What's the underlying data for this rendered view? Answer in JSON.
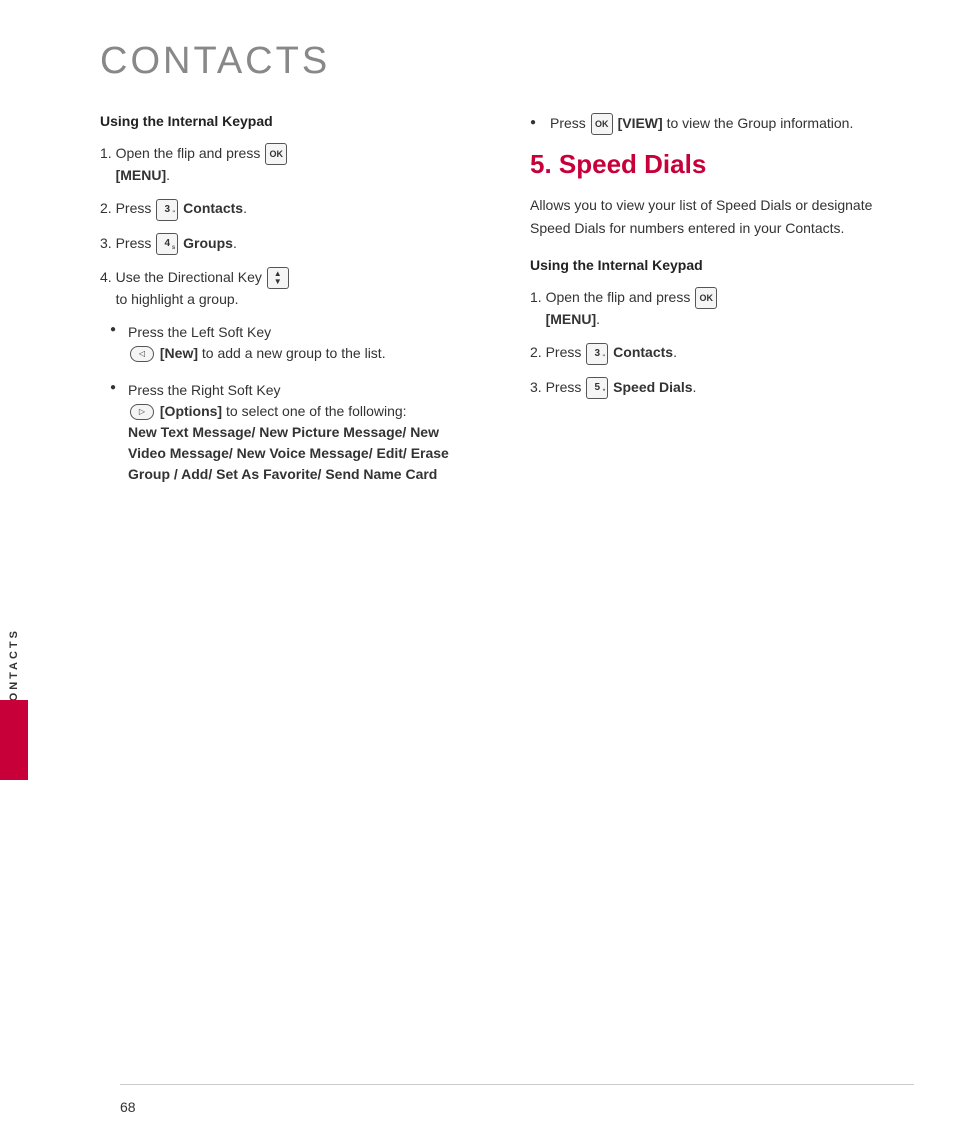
{
  "page": {
    "title": "CONTACTS",
    "page_number": "68",
    "sidebar_label": "CONTACTS"
  },
  "left_column": {
    "section_heading": "Using the Internal Keypad",
    "steps": [
      {
        "num": "1.",
        "text_before": "Open the flip and press",
        "key_ok": "OK",
        "text_bold": "[MENU]",
        "text_after": ""
      },
      {
        "num": "2.",
        "text_before": "Press",
        "key_num": "3",
        "key_sup": "\"",
        "text_bold": "Contacts",
        "text_after": "."
      },
      {
        "num": "3.",
        "text_before": "Press",
        "key_num": "4",
        "key_sup": "s",
        "text_bold": "Groups",
        "text_after": "."
      },
      {
        "num": "4.",
        "text_before": "Use the Directional Key",
        "key_dir": "⬆⬇",
        "text_after": "to highlight a group."
      }
    ],
    "bullets": [
      {
        "text_before": "Press the Left Soft Key",
        "key_soft": "◁",
        "text_bold": "[New]",
        "text_after": "to add a new group to the list."
      },
      {
        "text_before": "Press the Right Soft Key",
        "key_soft": "▷",
        "text_bold": "[Options]",
        "text_after": "to select one of the following:",
        "bold_list": "New Text Message/ New Picture Message/ New Video Message/ New Voice Message/ Edit/ Erase Group / Add/ Set As Favorite/ Send Name Card"
      }
    ]
  },
  "right_column": {
    "bullet": {
      "text_before": "Press",
      "key_ok": "OK",
      "text_bold": "[VIEW]",
      "text_after": "to view the Group information."
    },
    "speed_dials": {
      "heading": "5. Speed Dials",
      "description": "Allows you to view your list of Speed Dials or designate Speed Dials for numbers entered in your Contacts.",
      "section_heading": "Using the Internal Keypad",
      "steps": [
        {
          "num": "1.",
          "text_before": "Open the flip and press",
          "key_ok": "OK",
          "text_bold": "[MENU]",
          "text_after": ""
        },
        {
          "num": "2.",
          "text_before": "Press",
          "key_num": "3",
          "key_sup": "\"",
          "text_bold": "Contacts",
          "text_after": "."
        },
        {
          "num": "3.",
          "text_before": "Press",
          "key_num": "5",
          "key_sup": "*",
          "text_bold": "Speed Dials",
          "text_after": "."
        }
      ]
    }
  }
}
